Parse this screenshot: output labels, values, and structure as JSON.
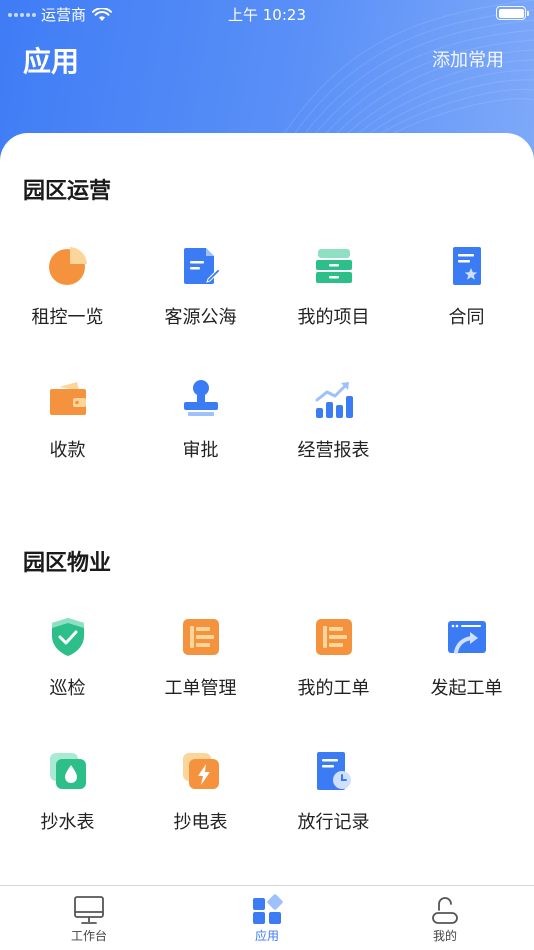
{
  "status_bar": {
    "carrier": "运营商",
    "time": "上午 10:23"
  },
  "header": {
    "title": "应用",
    "action": "添加常用"
  },
  "sections": [
    {
      "title": "园区运营",
      "items": [
        {
          "label": "租控一览",
          "icon": "pie-chart-icon"
        },
        {
          "label": "客源公海",
          "icon": "document-edit-icon"
        },
        {
          "label": "我的项目",
          "icon": "drawer-icon"
        },
        {
          "label": "合同",
          "icon": "contract-star-icon"
        },
        {
          "label": "收款",
          "icon": "wallet-icon"
        },
        {
          "label": "审批",
          "icon": "stamp-icon"
        },
        {
          "label": "经营报表",
          "icon": "bar-chart-trend-icon"
        }
      ]
    },
    {
      "title": "园区物业",
      "items": [
        {
          "label": "巡检",
          "icon": "shield-check-icon"
        },
        {
          "label": "工单管理",
          "icon": "list-board-icon"
        },
        {
          "label": "我的工单",
          "icon": "list-board-icon"
        },
        {
          "label": "发起工单",
          "icon": "upload-window-icon"
        },
        {
          "label": "抄水表",
          "icon": "water-drop-icon"
        },
        {
          "label": "抄电表",
          "icon": "lightning-icon"
        },
        {
          "label": "放行记录",
          "icon": "document-clock-icon"
        }
      ]
    }
  ],
  "tab_bar": {
    "tabs": [
      {
        "label": "工作台",
        "icon": "monitor-icon",
        "active": false
      },
      {
        "label": "应用",
        "icon": "apps-grid-icon",
        "active": true
      },
      {
        "label": "我的",
        "icon": "user-icon",
        "active": false
      }
    ]
  },
  "colors": {
    "primary": "#3b7cf5",
    "orange": "#f5923e",
    "green": "#2cbf8a"
  }
}
